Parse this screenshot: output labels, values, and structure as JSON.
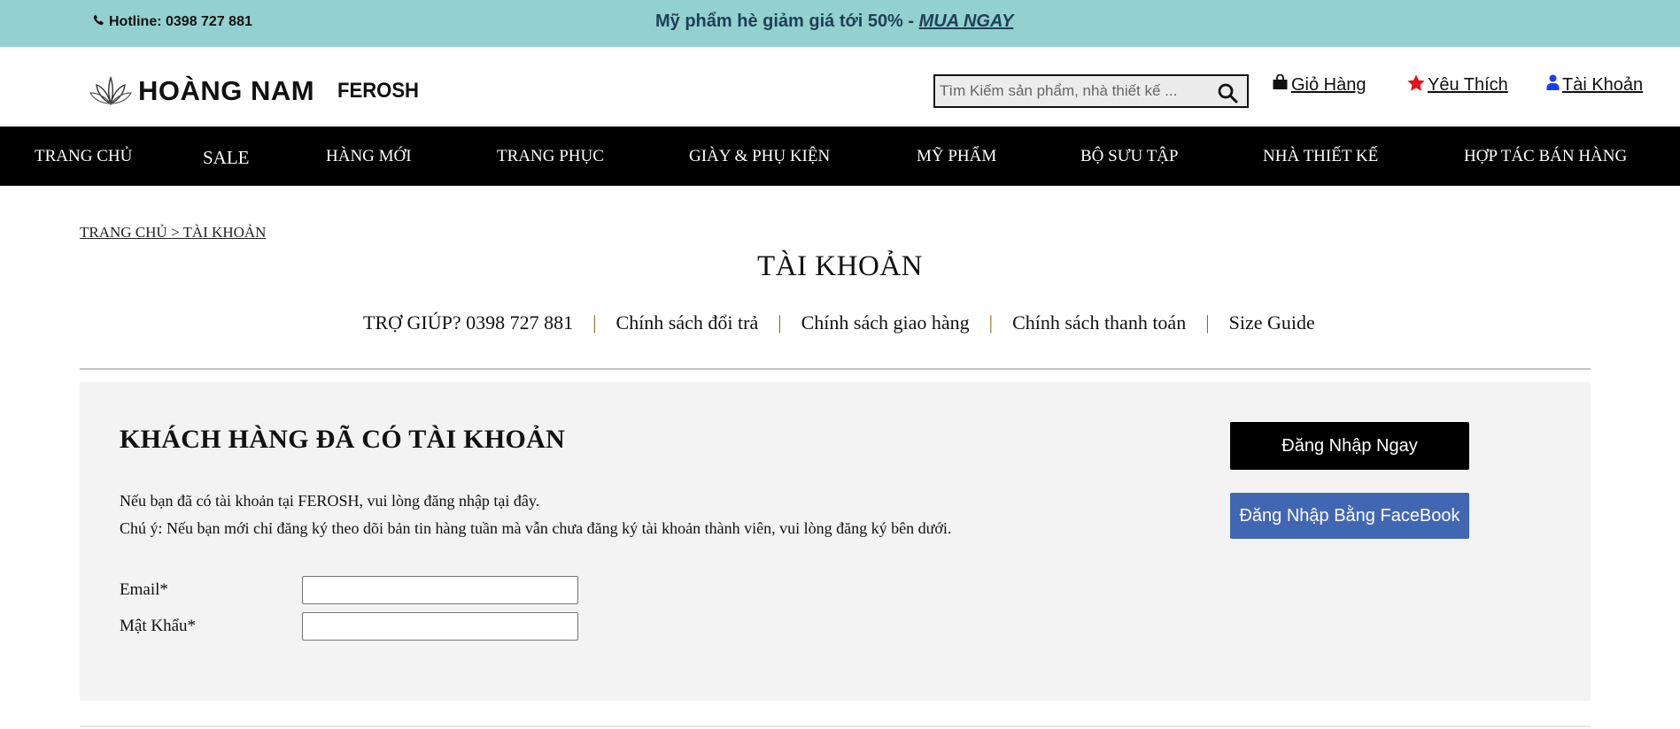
{
  "topbar": {
    "hotline": "Hotline: 0398 727 881",
    "promo_text": "Mỹ phẩm hè giảm giá tới 50% - ",
    "promo_link": "MUA NGAY"
  },
  "header": {
    "brand_name": "HOÀNG NAM",
    "brand_sub": "FEROSH",
    "search_placeholder": "Tìm Kiếm sản phẩm, nhà thiết kế ...",
    "cart": "Giỏ Hàng",
    "wishlist": "Yêu Thích",
    "account": "Tài Khoản"
  },
  "nav": {
    "items": [
      "TRANG CHỦ",
      "SALE",
      "HÀNG MỚI",
      "TRANG PHỤC",
      "GIÀY & PHỤ KIỆN",
      "MỸ PHẨM",
      "BỘ SƯU TẬP",
      "NHÀ THIẾT KẾ",
      "HỢP TÁC BÁN HÀNG"
    ]
  },
  "breadcrumb": "TRANG CHỦ > TÀI KHOẢN",
  "page_title": "TÀI KHOẢN",
  "help": {
    "phone": "TRỢ GIÚP? 0398 727 881",
    "returns": "Chính sách đổi trả",
    "shipping": "Chính sách giao hàng",
    "payment": "Chính sách thanh toán",
    "size_guide": "Size Guide",
    "separator": "|"
  },
  "login": {
    "title": "KHÁCH HÀNG ĐÃ CÓ TÀI KHOẢN",
    "intro": "Nếu bạn đã có tài khoản tại FEROSH, vui lòng đăng nhập tại đây.",
    "note": "Chú ý: Nếu bạn mới chỉ đăng ký theo dõi bản tin hàng tuần mà vẫn chưa đăng ký tài khoản thành viên, vui lòng đăng ký bên dưới.",
    "email_label": "Email*",
    "email_value": "",
    "password_label": "Mật Khẩu*",
    "password_value": "",
    "login_button": "Đăng Nhập Ngay",
    "facebook_button": "Đăng Nhập Bằng FaceBook"
  },
  "colors": {
    "topbar_bg": "#93d1d0",
    "nav_bg": "#000000",
    "facebook_blue": "#4267b2",
    "wishlist_star": "#e8101a",
    "account_icon": "#1a3ff0",
    "panel_bg": "#f3f3f3"
  },
  "icons": {
    "hotline": "phone-icon",
    "search": "search-icon",
    "cart": "shopping-bag-icon",
    "wishlist": "star-icon",
    "account": "user-icon",
    "logo": "lotus-logo-icon"
  }
}
